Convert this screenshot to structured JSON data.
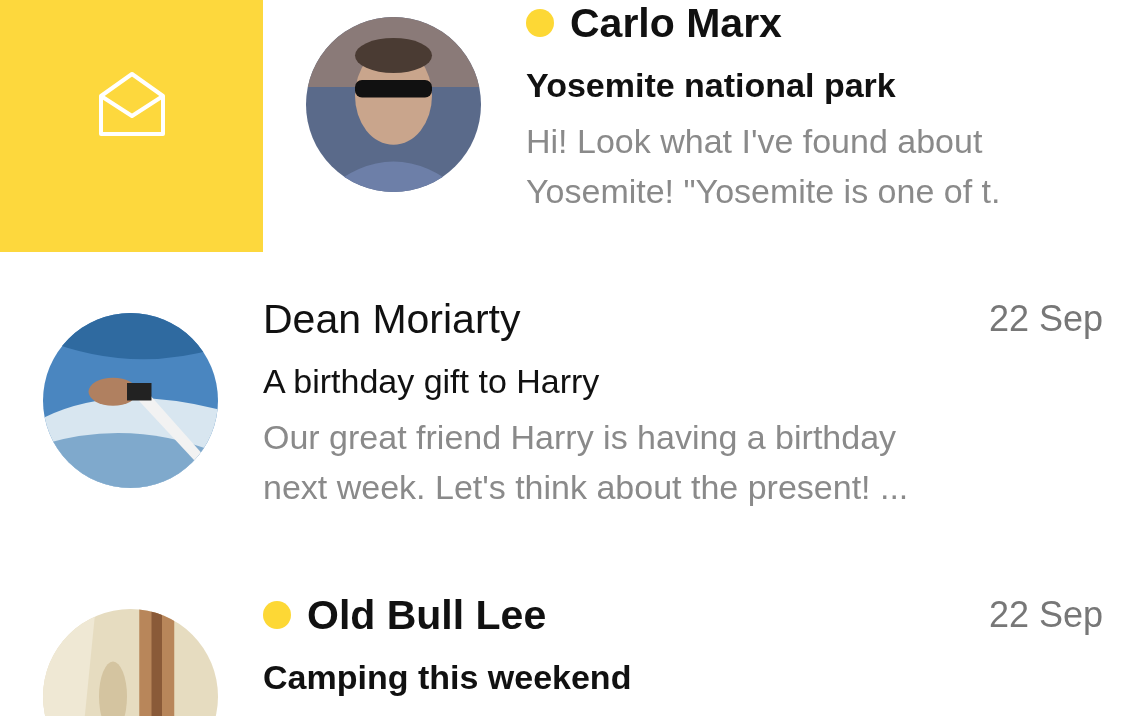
{
  "messages": [
    {
      "sender": "Carlo Marx",
      "unread": true,
      "swiped": true,
      "subject": "Yosemite national park",
      "preview": [
        "Hi! Look what I've found about",
        "Yosemite! \"Yosemite is one of t."
      ],
      "avatar": {
        "kind": "picture"
      }
    },
    {
      "sender": "Dean Moriarty",
      "unread": false,
      "swiped": false,
      "date": "22 Sep",
      "subject": "A birthday gift to Harry",
      "preview": [
        "Our great friend Harry is having a birthday",
        "next week. Let's think about the present! ..."
      ],
      "avatar": {
        "kind": "picture"
      }
    },
    {
      "sender": "Old Bull Lee",
      "unread": true,
      "swiped": false,
      "date": "22 Sep",
      "subject": "Camping this weekend",
      "avatar": {
        "kind": "picture"
      }
    }
  ]
}
